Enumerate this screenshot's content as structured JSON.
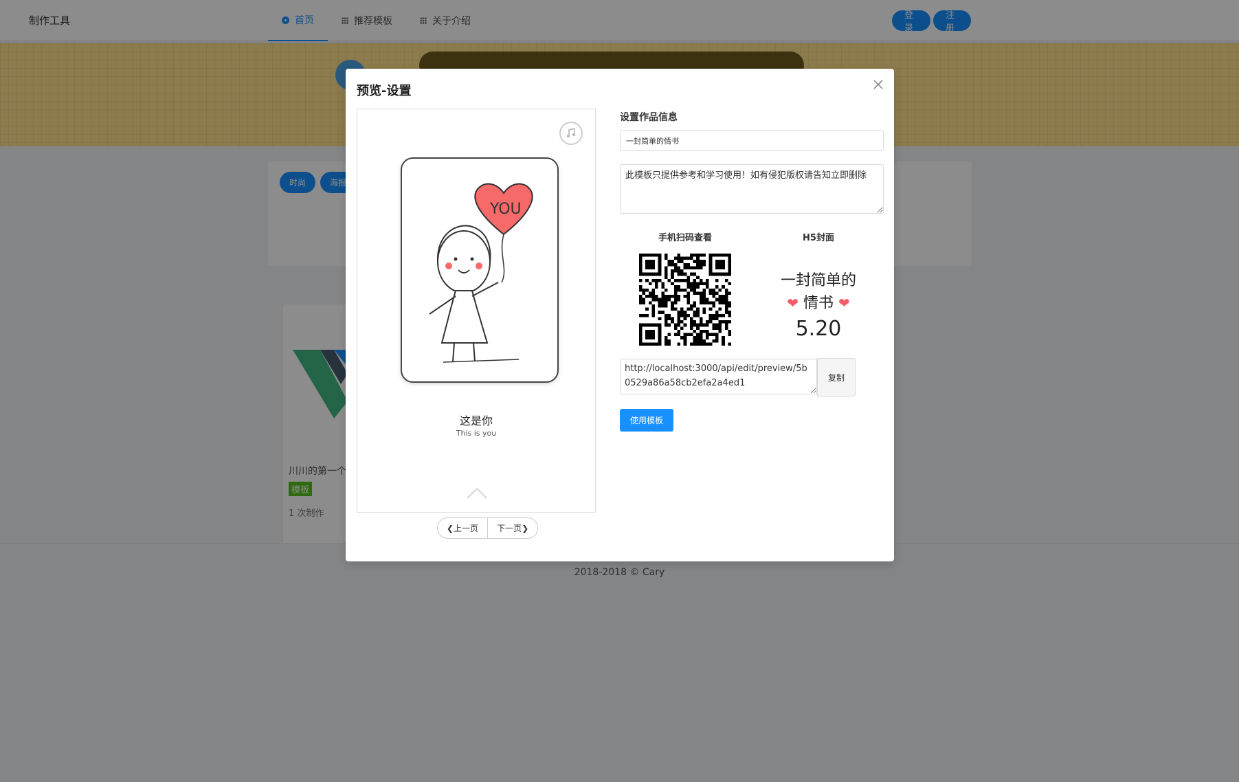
{
  "header": {
    "brand": "制作工具",
    "nav": [
      {
        "label": "首页",
        "icon": "home-dot-icon",
        "active": true
      },
      {
        "label": "推荐模板",
        "icon": "grid-icon",
        "active": false
      },
      {
        "label": "关于介绍",
        "icon": "grid-icon",
        "active": false
      }
    ],
    "login_label": "登录",
    "register_label": "注册"
  },
  "filters": {
    "tags": [
      "时尚",
      "海报"
    ]
  },
  "template_card": {
    "title": "川川的第一个",
    "tag": "模板",
    "usage": "1 次制作"
  },
  "footer": {
    "copyright": "2018-2018 © Cary"
  },
  "modal": {
    "title": "预览-设置",
    "preview": {
      "caption_cn": "这是你",
      "caption_en": "This is you",
      "heart_text": "YOU",
      "prev_label": "❮上一页",
      "next_label": "下一页❯"
    },
    "settings": {
      "section_label": "设置作品信息",
      "title_value": "一封简单的情书",
      "description_value": "此模板只提供参考和学习使用！如有侵犯版权请告知立即删除",
      "qr_label": "手机扫码查看",
      "cover_label": "H5封面",
      "cover": {
        "line1": "一封简单的",
        "line2": "情书",
        "date": "5.20"
      },
      "url_value": "http://localhost:3000/api/edit/preview/5b0529a86a58cb2efa2a4ed1",
      "copy_label": "复制",
      "use_template_label": "使用模板"
    }
  },
  "colors": {
    "primary": "#1890ff",
    "tag_green": "#52c41a",
    "heart_red": "#f45b69",
    "banner_yellow": "#ffe08a"
  }
}
